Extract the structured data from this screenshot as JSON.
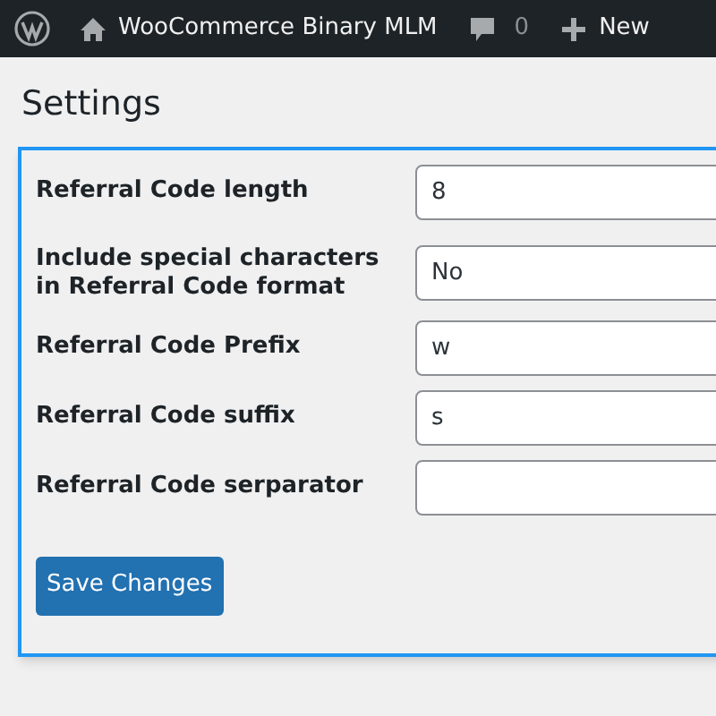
{
  "admin_bar": {
    "site_name": "WooCommerce Binary MLM",
    "comments_count": "0",
    "new_label": "New"
  },
  "page_title": "Settings",
  "settings": [
    {
      "label": "Referral Code length",
      "value": "8"
    },
    {
      "label": "Include special characters in Referral Code format",
      "value": "No"
    },
    {
      "label": "Referral Code Prefix",
      "value": "w"
    },
    {
      "label": "Referral Code suffix",
      "value": "s"
    },
    {
      "label": "Referral Code serparator"
    }
  ],
  "save_button": "Save Changes"
}
